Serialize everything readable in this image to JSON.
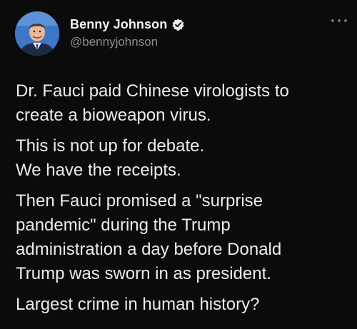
{
  "author": {
    "display_name": "Benny Johnson",
    "handle": "@bennyjohnson",
    "verified_icon": "verified-badge-icon",
    "avatar_icon": "profile-photo"
  },
  "menu": {
    "icon": "more-options-icon"
  },
  "tweet": {
    "paragraphs": [
      {
        "lines": [
          "Dr. Fauci paid Chinese virologists to",
          "create a bioweapon virus."
        ]
      },
      {
        "lines": [
          "This is not up for debate.",
          "We have the receipts."
        ]
      },
      {
        "lines": [
          "Then Fauci promised a \"surprise",
          "pandemic\" during the Trump",
          "administration a day before Donald",
          "Trump was sworn in as president."
        ]
      },
      {
        "lines": [
          "Largest crime in human history?"
        ]
      }
    ]
  },
  "colors": {
    "background": "#0b0b0b",
    "text": "#ececec",
    "muted": "#8b8f94",
    "verified": "#e7e9ea"
  }
}
